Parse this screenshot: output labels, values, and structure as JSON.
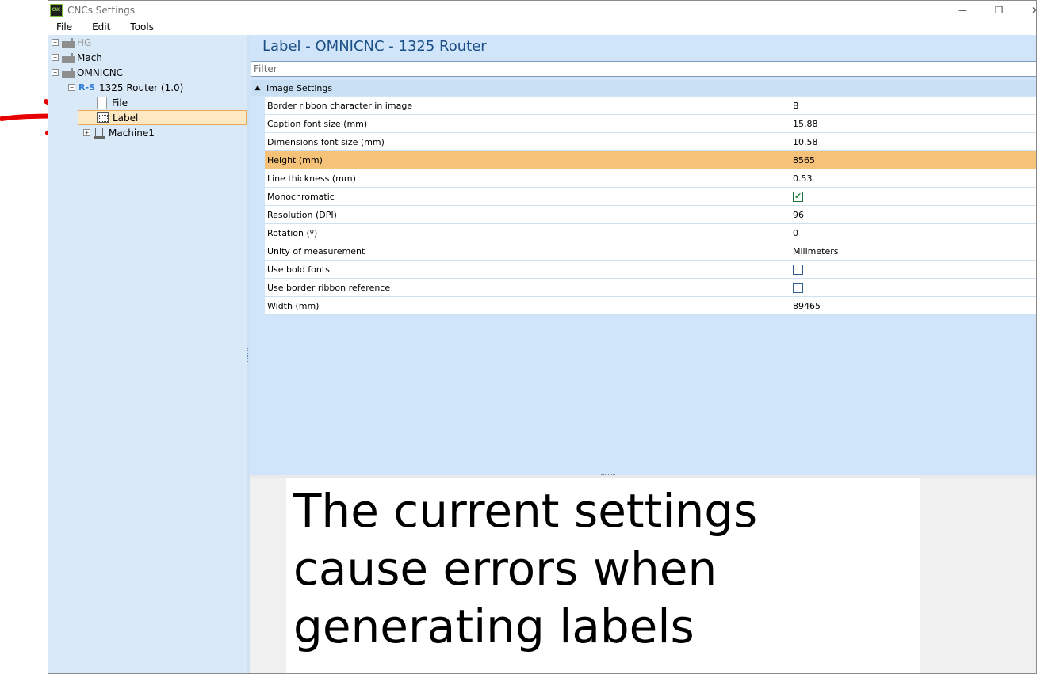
{
  "window": {
    "title": "CNCs Settings",
    "icon_text": "CNC",
    "controls": {
      "minimize": "—",
      "maximize": "❐",
      "close": "✕"
    }
  },
  "menu": [
    "File",
    "Edit",
    "Tools"
  ],
  "tree": {
    "items": [
      {
        "label": "HG",
        "expander": "+",
        "icon": "factory-icon"
      },
      {
        "label": "Mach",
        "expander": "+",
        "icon": "factory-icon"
      },
      {
        "label": "OMNICNC",
        "expander": "−",
        "icon": "factory-icon"
      },
      {
        "label": "1325 Router (1.0)",
        "expander": "−",
        "icon": "rs-icon",
        "icon_text": "R-S"
      },
      {
        "label": "File",
        "icon": "file-icon"
      },
      {
        "label": "Label",
        "icon": "label-icon",
        "selected": true
      },
      {
        "label": "Machine1",
        "expander": "+",
        "icon": "machine-icon"
      }
    ]
  },
  "panel": {
    "title": "Label - OMNICNC - 1325 Router",
    "filter_placeholder": "Filter",
    "category": {
      "chevron": "▲",
      "label": "Image Settings"
    },
    "properties": [
      {
        "name": "Border ribbon character in image",
        "value": "B"
      },
      {
        "name": "Caption font size (mm)",
        "value": "15.88"
      },
      {
        "name": "Dimensions font size (mm)",
        "value": "10.58"
      },
      {
        "name": "Height (mm)",
        "value": "8565",
        "selected": true
      },
      {
        "name": "Line thickness (mm)",
        "value": "0.53"
      },
      {
        "name": "Monochromatic",
        "checkbox": true,
        "checked": true
      },
      {
        "name": "Resolution (DPI)",
        "value": "96"
      },
      {
        "name": "Rotation (º)",
        "value": "0"
      },
      {
        "name": "Unity of measurement",
        "value": "Milimeters"
      },
      {
        "name": "Use bold fonts",
        "checkbox": true,
        "checked": false
      },
      {
        "name": "Use border ribbon reference",
        "checkbox": true,
        "checked": false
      },
      {
        "name": "Width (mm)",
        "value": "89465"
      }
    ]
  },
  "message": {
    "lines": [
      "The current settings",
      "cause errors when",
      "generating labels"
    ]
  },
  "colors": {
    "tree_bg": "#d9e9f8",
    "panel_bg": "#d0e5f9",
    "selected_row": "#f5c27a",
    "title_blue": "#1c4f86",
    "annotation_red": "#e60000"
  }
}
